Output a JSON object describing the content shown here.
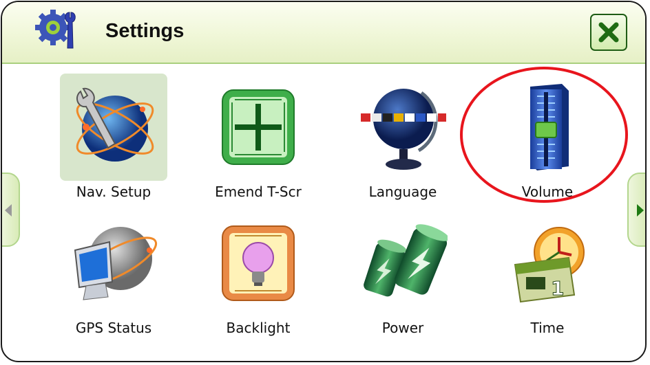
{
  "header": {
    "title": "Settings"
  },
  "items": [
    {
      "label": "Nav. Setup",
      "icon": "nav-setup-globe-wrench-icon",
      "selected": true
    },
    {
      "label": "Emend T-Scr",
      "icon": "touchscreen-calibration-crosshair-icon"
    },
    {
      "label": "Language",
      "icon": "language-globe-flags-icon"
    },
    {
      "label": "Volume",
      "icon": "volume-slider-icon"
    },
    {
      "label": "GPS Status",
      "icon": "gps-status-monitor-icon"
    },
    {
      "label": "Backlight",
      "icon": "backlight-lightbulb-icon"
    },
    {
      "label": "Power",
      "icon": "power-battery-icon"
    },
    {
      "label": "Time",
      "icon": "time-calendar-clock-icon"
    }
  ],
  "colors": {
    "accent": "#8fc562",
    "highlight": "#e8151d",
    "close": "#1e5c14"
  }
}
